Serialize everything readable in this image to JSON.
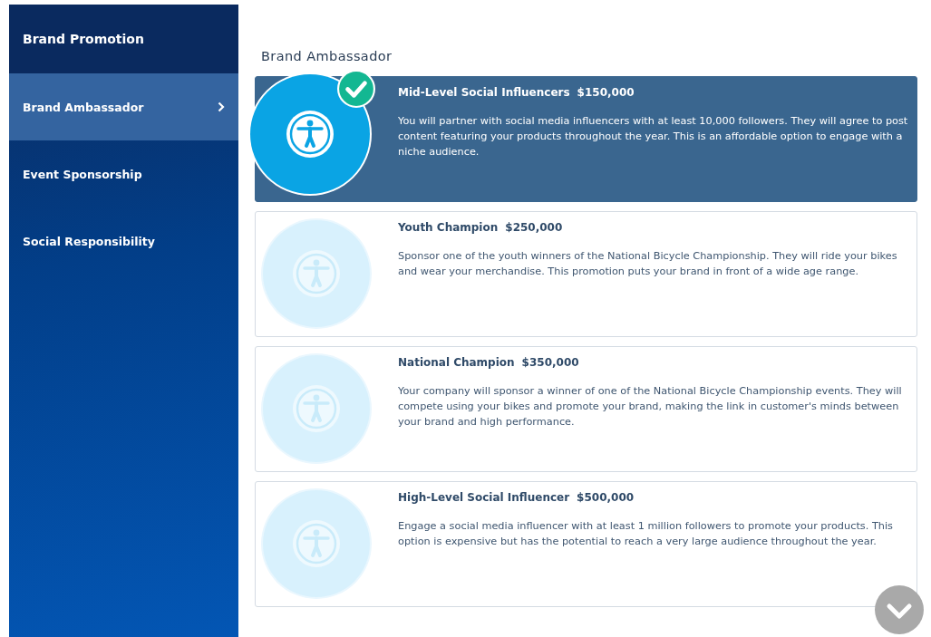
{
  "sidebar": {
    "title": "Brand Promotion",
    "items": [
      {
        "label": "Brand Ambassador",
        "selected": true
      },
      {
        "label": "Event Sponsorship",
        "selected": false
      },
      {
        "label": "Social Responsibility",
        "selected": false
      }
    ]
  },
  "section_title": "Brand Ambassador",
  "options": [
    {
      "name": "Mid-Level Social Influencers",
      "price": "$150,000",
      "description": "You will partner with social media influencers with at least 10,000 followers. They will agree to post content featuring your products throughout the year. This is an affordable option to engage with a niche audience.",
      "selected": true
    },
    {
      "name": "Youth Champion",
      "price": "$250,000",
      "description": "Sponsor one of the youth winners of the National Bicycle Championship. They will ride your bikes and wear your merchandise. This promotion puts your brand in front of a wide age range.",
      "selected": false
    },
    {
      "name": "National Champion",
      "price": "$350,000",
      "description": "Your company will sponsor a winner of one of the National Bicycle Championship events. They will compete using your bikes and promote your brand, making the link in customer's minds between your brand and high performance.",
      "selected": false
    },
    {
      "name": "High-Level Social Influencer",
      "price": "$500,000",
      "description": "Engage a social media influencer with at least 1 million followers to promote your products. This option is expensive but has the potential to reach a very large audience throughout the year.",
      "selected": false
    }
  ]
}
